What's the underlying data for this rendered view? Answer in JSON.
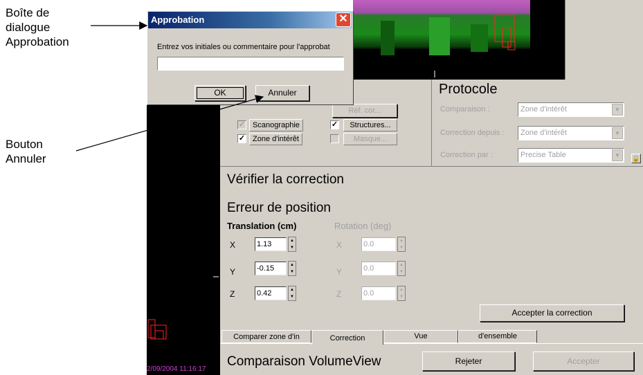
{
  "annotations": {
    "dialog_label": [
      "Boîte de",
      "dialogue",
      "Approbation"
    ],
    "cancel_label": [
      "Bouton",
      "Annuler"
    ]
  },
  "dialog": {
    "title": "Approbation",
    "prompt": "Entrez vos initiales ou commentaire pour l'approbat",
    "input_value": "",
    "ok": "OK",
    "cancel": "Annuler"
  },
  "options": {
    "ref_button": "Réf. cor...",
    "scan_label": "Scanographie",
    "roi_label": "Zone d'intérêt",
    "structures_label": "Structures...",
    "masque_label": "Masque...",
    "scan_checked": false,
    "roi_checked": true,
    "structures_checked": true,
    "masque_checked": false
  },
  "protocole": {
    "title": "Protocole",
    "rows": [
      {
        "label": "Comparaison :",
        "value": "Zone d'intérêt"
      },
      {
        "label": "Correction depuis :",
        "value": "Zone d'intérêt"
      },
      {
        "label": "Correction par :",
        "value": "Precise Table"
      }
    ]
  },
  "verify": {
    "title": "Vérifier la correction",
    "error_title": "Erreur de position",
    "translation_header": "Translation (cm)",
    "rotation_header": "Rotation (deg)",
    "axes": [
      "X",
      "Y",
      "Z"
    ],
    "translation": [
      "1.13",
      "-0.15",
      "0.42"
    ],
    "rotation": [
      "0.0",
      "0.0",
      "0.0"
    ],
    "accept_correction": "Accepter la correction"
  },
  "tabs": [
    "Comparer zone d'in",
    "Correction",
    "Vue",
    "d'ensemble"
  ],
  "bottom": {
    "title": "Comparaison VolumeView",
    "reject": "Rejeter",
    "accept": "Accepter"
  },
  "viewer": {
    "timestamp": "2/09/2004 11:16:17"
  },
  "colors": {
    "dialog_title_start": "#0a246a",
    "dialog_title_end": "#a6caf0",
    "close_red": "#e04830",
    "panel_gray": "#d4d0c8",
    "image_green": "#1a8a1a",
    "image_magenta": "#c060c0",
    "roi_red": "#ff2020",
    "timestamp_magenta": "#d040d0"
  }
}
